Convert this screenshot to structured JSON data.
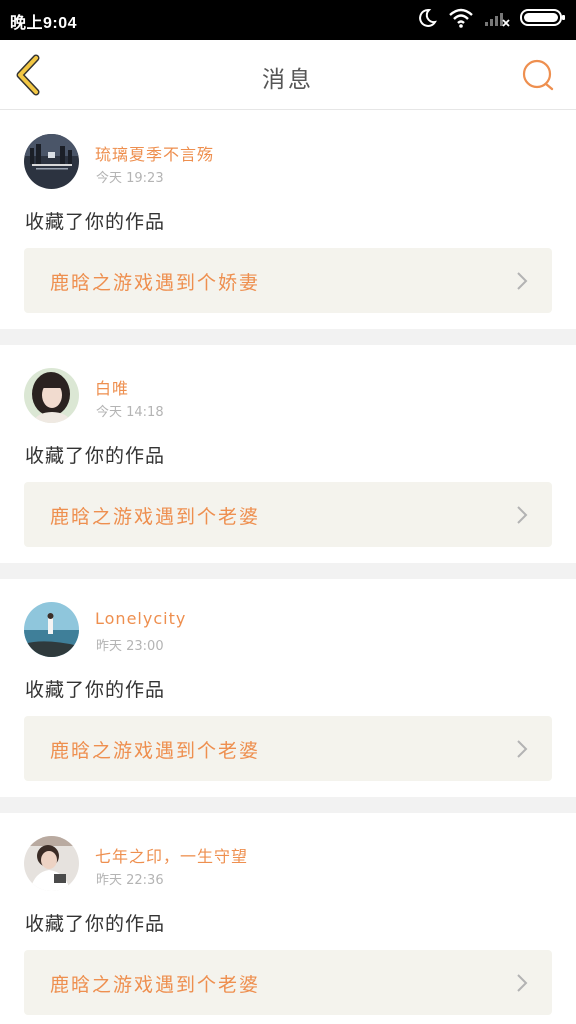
{
  "status_bar": {
    "time": "晚上9:04",
    "icons": [
      "moon-icon",
      "wifi-icon",
      "signal-icon",
      "battery-icon"
    ]
  },
  "nav": {
    "title": "消息",
    "back_icon": "chevron-left-icon",
    "search_icon": "search-icon"
  },
  "messages": [
    {
      "username": "琉璃夏季不言殇",
      "time": "今天 19:23",
      "action": "收藏了你的作品",
      "work_title": "鹿晗之游戏遇到个娇妻"
    },
    {
      "username": "白唯",
      "time": "今天 14:18",
      "action": "收藏了你的作品",
      "work_title": "鹿晗之游戏遇到个老婆"
    },
    {
      "username": "Lonelycity",
      "time": "昨天 23:00",
      "action": "收藏了你的作品",
      "work_title": "鹿晗之游戏遇到个老婆"
    },
    {
      "username": "七年之印，一生守望",
      "time": "昨天 22:36",
      "action": "收藏了你的作品",
      "work_title": "鹿晗之游戏遇到个老婆"
    }
  ],
  "colors": {
    "accent": "#ee8f4f",
    "back_icon": "#f2c744",
    "card_bg": "#f4f3ed",
    "divider": "#f2f2f2"
  }
}
